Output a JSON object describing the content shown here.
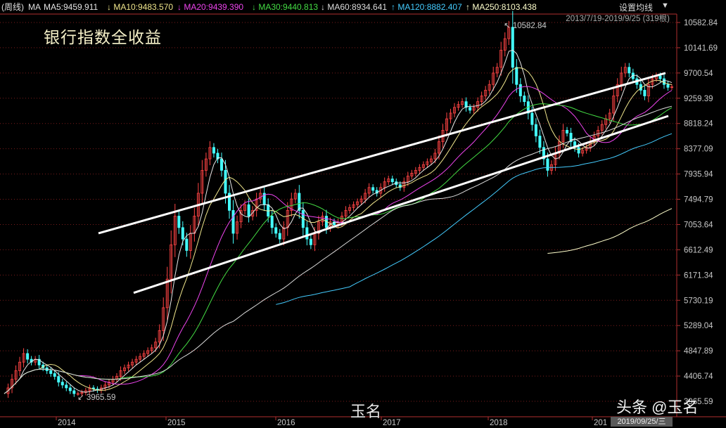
{
  "header": {
    "period": "(周线)",
    "ma_label": "MA",
    "ma_items": [
      {
        "label": "MA5:9459.911",
        "arrow": "",
        "color": "#e6e6e6"
      },
      {
        "label": "MA10:9483.570",
        "arrow": "↓",
        "color": "#f0e68c"
      },
      {
        "label": "MA20:9439.390",
        "arrow": "↓",
        "color": "#ee44ee"
      },
      {
        "label": "MA30:9440.813",
        "arrow": "↓",
        "color": "#44dd44"
      },
      {
        "label": "MA60:8934.641",
        "arrow": "↓",
        "color": "#dddddd"
      },
      {
        "label": "MA120:8882.407",
        "arrow": "↑",
        "color": "#44ccff"
      },
      {
        "label": "MA250:8103.438",
        "arrow": "↑",
        "color": "#ffffcc"
      }
    ],
    "settings_label": "设置均线",
    "settings_arrow": "▼",
    "range_text": "2013/7/19-2019/9/25 (319根)"
  },
  "title": "银行指数全收益",
  "watermarks": {
    "weibo": "玉名",
    "toutiao": "头条 @玉名"
  },
  "current_date_box": "2019/09/25/三",
  "colors": {
    "background": "#000000",
    "up_candle": "#ff4444",
    "down_candle": "#44ffff",
    "ma5": "#e6e6e6",
    "ma10": "#f0e68c",
    "ma20": "#ee44ee",
    "ma30": "#44dd44",
    "ma60": "#dddddd",
    "ma120": "#44ccff",
    "ma250": "#ffffcc",
    "channel": "#ffffff"
  },
  "chart_data": {
    "type": "candlestick-weekly",
    "y_ticks": [
      "10582.84",
      "10141.69",
      "9700.54",
      "9259.39",
      "8818.24",
      "8377.09",
      "7935.94",
      "7494.79",
      "7053.64",
      "6612.49",
      "6171.34",
      "5730.19",
      "5289.04",
      "4847.89",
      "4406.74",
      "3965.59"
    ],
    "ylim": [
      3965.59,
      10582.84
    ],
    "x_year_labels": [
      "2014",
      "2015",
      "2016",
      "2017",
      "2018",
      "201"
    ],
    "annotations": [
      {
        "text": "10582.84",
        "kind": "high"
      },
      {
        "text": "3965.59",
        "kind": "low"
      }
    ],
    "trend_channel": [
      {
        "name": "upper",
        "from": [
          "2014-06",
          6900
        ],
        "to": [
          "2019-09",
          9700
        ]
      },
      {
        "name": "lower",
        "from": [
          "2014-09",
          5860
        ],
        "to": [
          "2019-09",
          8950
        ]
      }
    ],
    "weekly_close": [
      4100,
      4200,
      4350,
      4500,
      4650,
      4800,
      4700,
      4650,
      4700,
      4600,
      4550,
      4500,
      4450,
      4400,
      4300,
      4250,
      4200,
      4150,
      4100,
      4100,
      4120,
      4150,
      4200,
      4180,
      4160,
      4200,
      4250,
      4300,
      4350,
      4400,
      4500,
      4550,
      4600,
      4650,
      4700,
      4750,
      4800,
      4850,
      4900,
      5000,
      5200,
      5600,
      6100,
      6700,
      7200,
      7000,
      6800,
      6600,
      6900,
      7200,
      7600,
      8000,
      8200,
      8400,
      8300,
      8200,
      8000,
      7600,
      7300,
      6900,
      7100,
      7300,
      7400,
      7200,
      7300,
      7500,
      7600,
      7400,
      7200,
      7000,
      6900,
      6800,
      7000,
      7300,
      7500,
      7600,
      7300,
      7000,
      6800,
      6700,
      6900,
      7100,
      7200,
      7000,
      7100,
      7050,
      7100,
      7200,
      7300,
      7350,
      7400,
      7450,
      7500,
      7600,
      7700,
      7650,
      7600,
      7700,
      7800,
      7850,
      7800,
      7750,
      7700,
      7800,
      7900,
      7950,
      8000,
      8050,
      8100,
      8150,
      8200,
      8300,
      8500,
      8700,
      8900,
      9000,
      9100,
      9150,
      9200,
      9100,
      9050,
      9100,
      9200,
      9300,
      9400,
      9500,
      9700,
      9800,
      10100,
      10300,
      10500,
      9800,
      9500,
      9300,
      9200,
      9000,
      8800,
      8600,
      8400,
      8200,
      8000,
      8100,
      8300,
      8500,
      8700,
      8650,
      8500,
      8400,
      8300,
      8350,
      8400,
      8500,
      8600,
      8700,
      8800,
      8900,
      9000,
      9300,
      9500,
      9700,
      9800,
      9700,
      9600,
      9500,
      9400,
      9300,
      9500,
      9600,
      9650,
      9600,
      9500,
      9450,
      9460
    ],
    "ma_series": [
      {
        "name": "MA5",
        "period": 5
      },
      {
        "name": "MA10",
        "period": 10
      },
      {
        "name": "MA20",
        "period": 20
      },
      {
        "name": "MA30",
        "period": 30
      },
      {
        "name": "MA60",
        "period": 60
      },
      {
        "name": "MA120",
        "period": 120
      },
      {
        "name": "MA250",
        "period": 250
      }
    ]
  }
}
